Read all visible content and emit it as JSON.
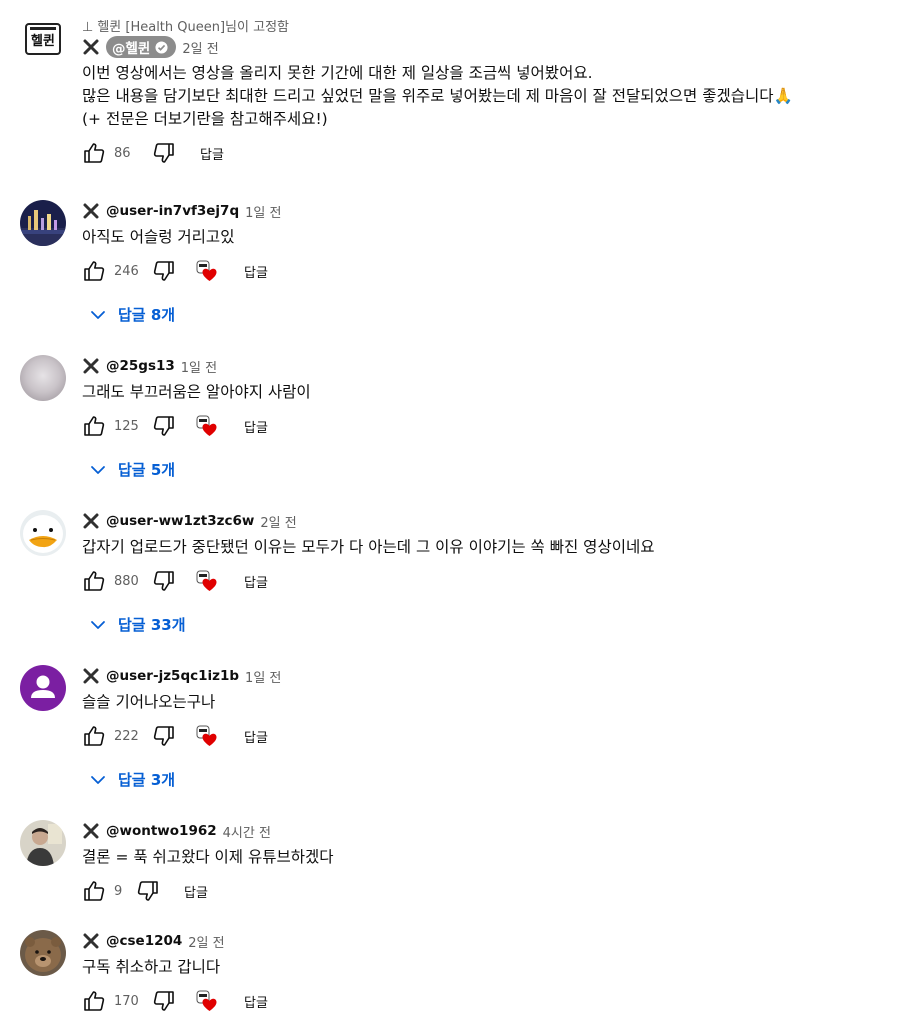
{
  "pinned": {
    "pin_text": "헬퀸 [Health Queen]님이 고정함",
    "avatar_text": "헬퀸",
    "author": "@헬퀸",
    "time": "2일 전",
    "lines": [
      "이번 영상에서는 영상을 올리지 못한 기간에 대한 제 일상을 조금씩 넣어봤어요.",
      "많은 내용을 담기보단 최대한 드리고 싶었던 말을 위주로 넣어봤는데 제 마음이 잘 전달되었으면 좋겠습니다🙏",
      "(+ 전문은 더보기란을 참고해주세요!)"
    ],
    "likes": "86",
    "reply_label": "답글"
  },
  "comments": [
    {
      "author": "@user-in7vf3ej7q",
      "time": "1일 전",
      "text": "아직도 어슬렁 거리고있",
      "likes": "246",
      "reply_label": "답글",
      "replies": "답글 8개",
      "avatar": "city-night"
    },
    {
      "author": "@25gs13",
      "time": "1일 전",
      "text": "그래도 부끄러움은 알아야지 사람이",
      "likes": "125",
      "reply_label": "답글",
      "replies": "답글 5개",
      "avatar": "blurred"
    },
    {
      "author": "@user-ww1zt3zc6w",
      "time": "2일 전",
      "text": "갑자기 업로드가 중단됐던 이유는 모두가 다 아는데 그 이유 이야기는 쏙 빠진 영상이네요",
      "likes": "880",
      "reply_label": "답글",
      "replies": "답글 33개",
      "avatar": "duck"
    },
    {
      "author": "@user-jz5qc1iz1b",
      "time": "1일 전",
      "text": "슬슬 기어나오는구나",
      "likes": "222",
      "reply_label": "답글",
      "replies": "답글 3개",
      "avatar": "default-purple"
    },
    {
      "author": "@wontwo1962",
      "time": "4시간 전",
      "text": "결론 = 푹 쉬고왔다 이제 유튜브하겠다",
      "likes": "9",
      "reply_label": "답글",
      "avatar": "person"
    },
    {
      "author": "@cse1204",
      "time": "2일 전",
      "text": "구독 취소하고 갑니다",
      "likes": "170",
      "reply_label": "답글",
      "avatar": "bear"
    }
  ],
  "colors": {
    "link": "#065fd4",
    "meta": "#606060",
    "heart": "#e00000",
    "default_avatar": "#7b1fa2"
  }
}
